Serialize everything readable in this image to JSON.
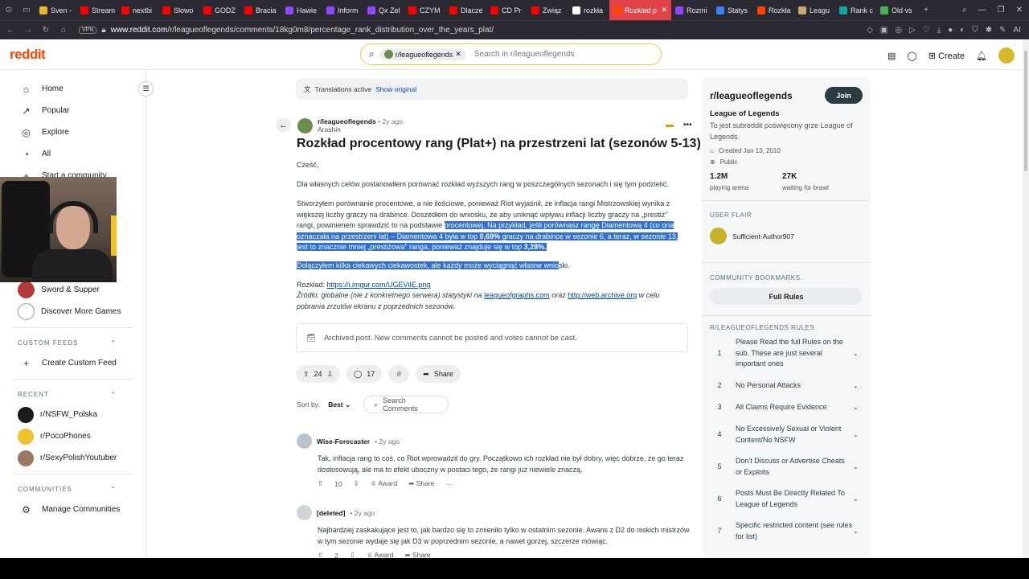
{
  "browser": {
    "tabs": [
      {
        "label": "Sven -",
        "color": "#e8b41f"
      },
      {
        "label": "Stream",
        "color": "#ff0000"
      },
      {
        "label": "nextbi",
        "color": "#ff0000"
      },
      {
        "label": "Słowo",
        "color": "#ff0000"
      },
      {
        "label": "GODZ",
        "color": "#ff0000"
      },
      {
        "label": "Bracia",
        "color": "#ff0000"
      },
      {
        "label": "Hawie",
        "color": "#9146ff"
      },
      {
        "label": "Inform",
        "color": "#9146ff"
      },
      {
        "label": "Qx Zel",
        "color": "#9146ff"
      },
      {
        "label": "CZYM",
        "color": "#ff0000"
      },
      {
        "label": "Dlacze",
        "color": "#ff0000"
      },
      {
        "label": "CD Pr",
        "color": "#ff0000"
      },
      {
        "label": "Związ",
        "color": "#ff0000"
      },
      {
        "label": "rozkła",
        "color": "#ffffff"
      },
      {
        "label": "Rozkład p",
        "color": "#ff4500",
        "active": true
      },
      {
        "label": "Rozmi",
        "color": "#9146ff"
      },
      {
        "label": "Statys",
        "color": "#3b82f6"
      },
      {
        "label": "Rozkła",
        "color": "#ff4500"
      },
      {
        "label": "Leagu",
        "color": "#c8aa6e"
      },
      {
        "label": "Rank c",
        "color": "#16a3a3"
      },
      {
        "label": "Old vs",
        "color": "#4caf50"
      }
    ],
    "new_tab": "+",
    "vpn": "VPN",
    "url_prefix": "www.reddit.com",
    "url_path": "/r/leagueoflegends/comments/18kg0m8/percentage_rank_distribution_over_the_years_plat/",
    "ai_label": "AI"
  },
  "header": {
    "logo": "reddit",
    "search_chip": "r/leagueoflegends",
    "search_placeholder": "Search in r/leagueoflegends",
    "create": "Create"
  },
  "sidebar": {
    "nav": [
      {
        "label": "Home",
        "icon": "home-icon"
      },
      {
        "label": "Popular",
        "icon": "popular-icon"
      },
      {
        "label": "Explore",
        "icon": "explore-icon"
      },
      {
        "label": "All",
        "icon": "all-icon"
      },
      {
        "label": "Start a community",
        "icon": "plus-icon"
      }
    ],
    "games": [
      {
        "label": "Quiz Planet",
        "color": "#3a57c5"
      },
      {
        "label": "Sword & Supper",
        "color": "#b33a3a"
      },
      {
        "label": "Discover More Games",
        "color": "#ffffff"
      }
    ],
    "custom_feeds_title": "CUSTOM FEEDS",
    "create_custom_feed": "Create Custom Feed",
    "recent_title": "RECENT",
    "recent": [
      {
        "label": "r/NSFW_Polska",
        "color": "#1a1a1b"
      },
      {
        "label": "r/PocoPhones",
        "color": "#f2c12e"
      },
      {
        "label": "r/SexyPolishYoutuber",
        "color": "#9a7a64"
      }
    ],
    "communities_title": "COMMUNITIES",
    "manage_communities": "Manage Communities"
  },
  "post": {
    "translation_text": "Translations active",
    "show_original": "Show original",
    "subreddit": "r/leagueoflegends",
    "time": "• 2y ago",
    "author": "Arashin",
    "title": "Rozkład procentowy rang (Plat+) na przestrzeni lat (sezonów 5-13)",
    "p1": "Cześć,",
    "p2": "Dla własnych celów postanowiłem porównać rozkład wyższych rang w poszczególnych sezonach i się tym podzielić.",
    "p3_a": "Stworzyłem porównanie procentowe, a nie ilościowe, ponieważ Riot wyjaśnił, że inflacja rangi Mistrzowskiej wynika z większej liczby graczy na drabince. Doszedłem do wniosku, że aby uniknąć wpływu inflacji liczby graczy na „prestiż” rangi, powinienem sprawdzić to na podstawie ",
    "p3_b": "procentowej. Na przykład, jeśli porównasz rangę Diamentową 4 (co ona oznaczała na przestrzeni lat) – Diamentowa 4 była w top ",
    "p3_c": "0,69%",
    "p3_d": " graczy na drabince w sezonie 6, a teraz, w sezonie 13, jest to znacznie mniej „prestiżowa” ranga, ponieważ znajduje się w top ",
    "p3_e": "3,28%.",
    "p4_a": "Dołączyłem kilka ciekawych ciekawostek, ale każdy może wyciągnąć własne wnio",
    "p4_b": "ski.",
    "p5_label": "Rozkład: ",
    "p5_link": "https://i.imgur.com/UGEViIE.png",
    "p6_a": "Źródło: globalne (nie z konkretnego serwera) statystyki na ",
    "p6_link1": "leagueofgraphs.com",
    "p6_b": "  oraz ",
    "p6_link2": "http://web.archive.org",
    "p6_c": "  w celu pobrania zrzutów ekranu z poprzednich sezonów.",
    "archived": "Archived post. New comments cannot be posted and votes cannot be cast.",
    "votes": "24",
    "comments": "17",
    "share": "Share",
    "sort_by": "Sort by:",
    "sort_value": "Best",
    "search_comments": "Search Comments"
  },
  "comments": [
    {
      "user": "Wise-Forecaster",
      "time": "• 2y ago",
      "body": "Tak, inflacja rang to coś, co Riot wprowadził do gry. Początkowo ich rozkład nie był dobry, więc dobrze, że go teraz dostosowują, ale ma to efekt uboczny w postaci tego, że rangi już niewiele znaczą.",
      "votes": "10",
      "award": "Award",
      "share": "Share",
      "more": "···"
    },
    {
      "user": "[deleted]",
      "time": "• 2y ago",
      "body": "Najbardziej zaskakujące jest to, jak bardzo się to zmieniło tylko w ostatnim sezonie. Awans z D2 do niskich mistrzów w tym sezonie wydaje się jak D3 w poprzednim sezonie, a nawet gorzej, szczerze mówiąc.",
      "votes": "2",
      "award": "Award",
      "share": "Share",
      "more": ""
    }
  ],
  "right": {
    "name": "r/leagueoflegends",
    "join": "Join",
    "subtitle": "League of Legends",
    "description": "To jest subreddit poświęcony grze League of Legends.",
    "created": "Created Jan 13, 2010",
    "visibility": "Public",
    "members": "1.2M",
    "members_label": "playing arena",
    "online": "27K",
    "online_label": "waiting for brawl",
    "user_flair_title": "USER FLAIR",
    "flair_user": "Sufficient-Author907",
    "bookmarks_title": "COMMUNITY BOOKMARKS",
    "full_rules": "Full Rules",
    "rules_title": "R/LEAGUEOFLEGENDS RULES",
    "rules": [
      {
        "n": "1",
        "text": "Please Read the full Rules on the sub. These are just several important ones"
      },
      {
        "n": "2",
        "text": "No Personal Attacks"
      },
      {
        "n": "3",
        "text": "All Claims Require Evidence"
      },
      {
        "n": "4",
        "text": "No Excessively Sexual or Violent Content/No NSFW"
      },
      {
        "n": "5",
        "text": "Don't Discuss or Advertise Cheats or Exploits"
      },
      {
        "n": "6",
        "text": "Posts Must Be Directly Related To League of Legends"
      },
      {
        "n": "7",
        "text": "Specific restricted content (see rules for list)"
      }
    ]
  }
}
